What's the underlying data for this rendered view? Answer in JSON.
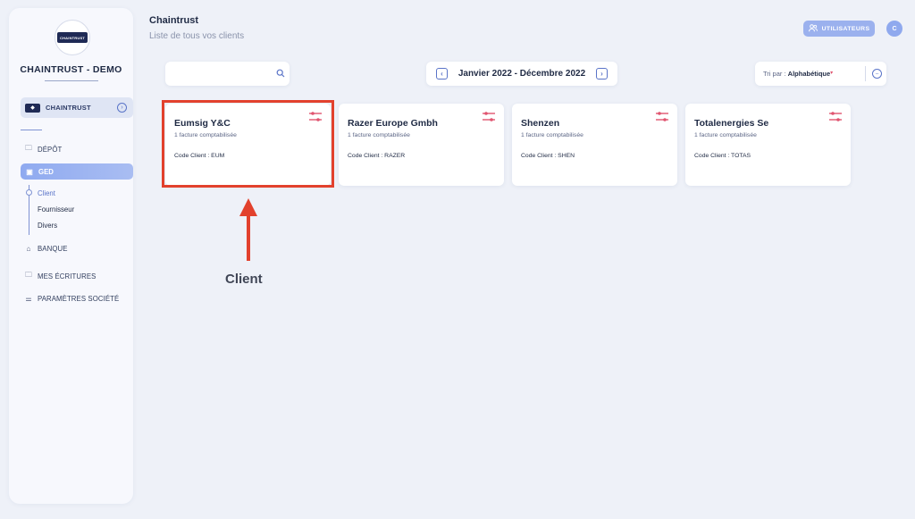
{
  "sidebar": {
    "logo_text": "CHAINTRUST",
    "company_name": "CHAINTRUST - DEMO",
    "org_selector": {
      "label": "CHAINTRUST",
      "badge": "◆"
    },
    "nav": [
      {
        "label": "DÉPÔT",
        "icon": "folder-icon"
      },
      {
        "label": "GED",
        "icon": "document-icon",
        "active": true
      },
      {
        "label": "BANQUE",
        "icon": "bank-icon"
      },
      {
        "label": "MES ÉCRITURES",
        "icon": "folder-icon"
      },
      {
        "label": "PARAMÈTRES SOCIÉTÉ",
        "icon": "sliders-icon"
      }
    ],
    "ged_subitems": [
      {
        "label": "Client",
        "active": true
      },
      {
        "label": "Fournisseur"
      },
      {
        "label": "Divers"
      }
    ]
  },
  "header": {
    "title": "Chaintrust",
    "subtitle": "Liste de tous vos clients",
    "users_button": "UTILISATEURS",
    "avatar_initial": "C"
  },
  "toolbar": {
    "search_value": "",
    "period_label": "Janvier 2022 - Décembre 2022",
    "sort_prefix": "Tri par : ",
    "sort_value": "Alphabétique"
  },
  "clients": [
    {
      "name": "Eumsig Y&C",
      "count": "1 facture comptabilisée",
      "code": "Code Client : EUM"
    },
    {
      "name": "Razer Europe Gmbh",
      "count": "1 facture comptabilisée",
      "code": "Code Client : RAZER"
    },
    {
      "name": "Shenzen",
      "count": "1 facture comptabilisée",
      "code": "Code Client : SHEN"
    },
    {
      "name": "Totalenergies Se",
      "count": "1 facture comptabilisée",
      "code": "Code Client : TOTAS"
    }
  ],
  "annotation": {
    "label": "Client"
  },
  "colors": {
    "accent": "#5a74c8",
    "highlight": "#e2412d",
    "settings_icon": "#e0546f",
    "background": "#eef1f8"
  }
}
